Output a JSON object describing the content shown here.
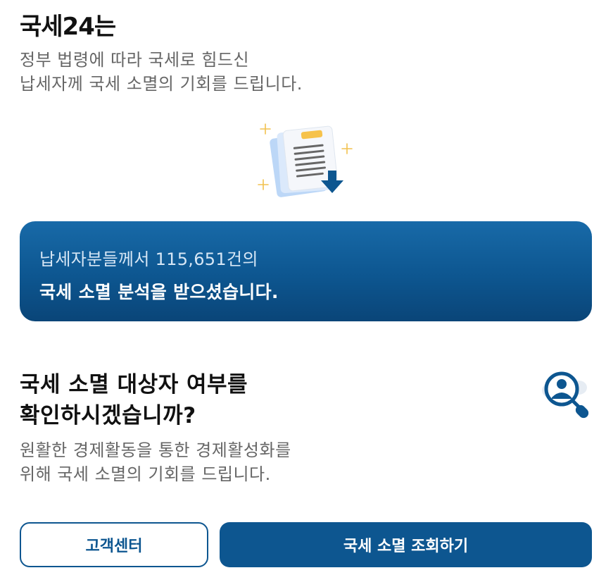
{
  "header": {
    "title": "국세24는",
    "intro_lines": [
      "정부 법령에 따라 국세로 힘드신",
      "납세자께 국세 소멸의 기회를 드립니다."
    ]
  },
  "illustration": {
    "icon": "document-download-icon"
  },
  "banner": {
    "line1": "납세자분들께서 115,651건의",
    "line2": "국세 소멸 분석을 받으셨습니다."
  },
  "question": {
    "title_lines": [
      "국세 소멸 대상자 여부를",
      "확인하시겠습니까?"
    ],
    "desc_lines": [
      "원활한 경제활동을 통한 경제활성화를",
      "위해 국세 소멸의 기회를 드립니다."
    ],
    "icon": "user-search-icon"
  },
  "buttons": {
    "customer_center": "고객센터",
    "check": "국세 소멸 조회하기"
  },
  "colors": {
    "primary": "#0d5690",
    "banner_top": "#186aa8",
    "banner_bottom": "#0a4578",
    "sparkle": "#f2c14e",
    "muted_text": "#666666"
  }
}
